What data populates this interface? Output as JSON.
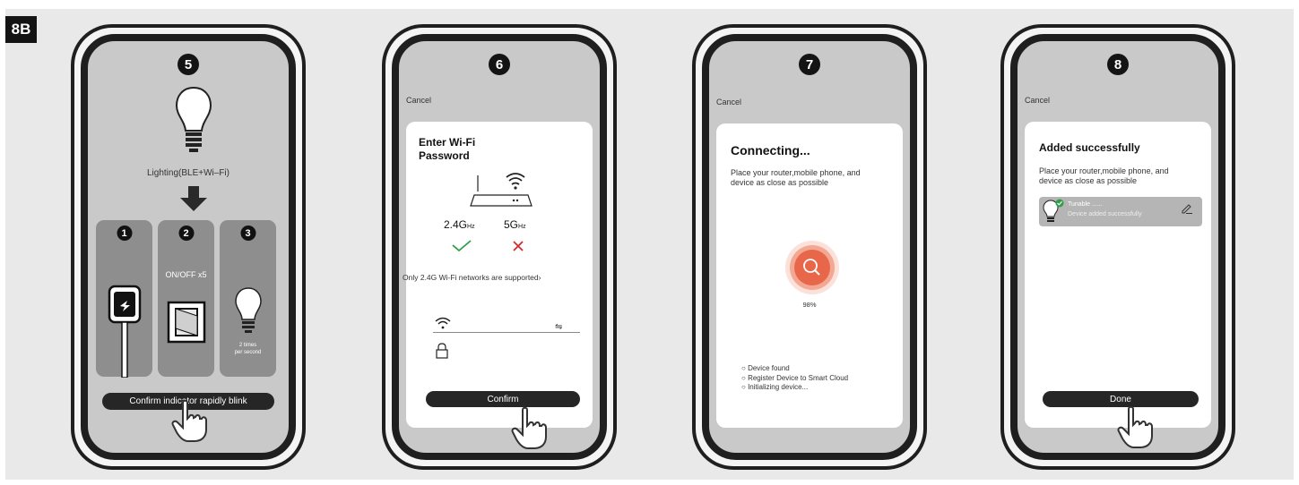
{
  "figure_label": "8B",
  "steps": [
    {
      "number": "5",
      "lighting_label": "Lighting(BLE+Wi–Fi)",
      "columns": [
        {
          "number": "1"
        },
        {
          "number": "2",
          "text": "ON/OFF x5"
        },
        {
          "number": "3",
          "text_line1": "2 times",
          "text_line2": "per second"
        }
      ],
      "button_label": "Confirm indicator rapidly blink"
    },
    {
      "number": "6",
      "cancel_label": "Cancel",
      "title_line1": "Enter Wi-Fi",
      "title_line2": "Password",
      "band_24": "2.4G",
      "band_24_unit": "Hz",
      "band_5": "5G",
      "band_5_unit": "Hz",
      "note": "Only 2.4G Wi-Fi networks are supported›",
      "button_label": "Confirm"
    },
    {
      "number": "7",
      "cancel_label": "Cancel",
      "title": "Connecting...",
      "desc_line1": "Place your router,mobile phone, and",
      "desc_line2": "device as close as possible",
      "progress_label": "98%",
      "progress_value": 98,
      "status_items": [
        "Device found",
        "Register Device to Smart Cloud",
        "Initializing device..."
      ]
    },
    {
      "number": "8",
      "cancel_label": "Cancel",
      "title": "Added successfully",
      "desc_line1": "Place your router,mobile phone, and",
      "desc_line2": "device as close as possible",
      "device_name": "Tunable ......",
      "device_status": "Device added successfully",
      "button_label": "Done"
    }
  ],
  "colors": {
    "accent_orange": "#e8664a",
    "check_green": "#2f9e47",
    "cross_red": "#d62b2b",
    "dark": "#262626"
  }
}
